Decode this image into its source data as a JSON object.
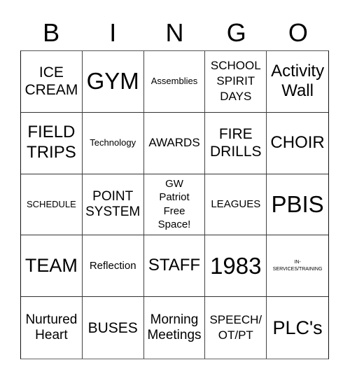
{
  "header": {
    "letters": [
      "B",
      "I",
      "N",
      "G",
      "O"
    ]
  },
  "cells": [
    {
      "text": "ICE\nCREAM",
      "size": "s-lg"
    },
    {
      "text": "GYM",
      "size": "s-xxl"
    },
    {
      "text": "Assemblies",
      "size": "s-sm"
    },
    {
      "text": "SCHOOL\nSPIRIT\nDAYS",
      "size": "s-md"
    },
    {
      "text": "Activity\nWall",
      "size": "s-lg2"
    },
    {
      "text": "FIELD\nTRIPS",
      "size": "s-lg2"
    },
    {
      "text": "Technology",
      "size": "s-sm"
    },
    {
      "text": "AWARDS",
      "size": "s-md"
    },
    {
      "text": "FIRE\nDRILLS",
      "size": "s-lg"
    },
    {
      "text": "CHOIR",
      "size": "s-lg2"
    },
    {
      "text": "SCHEDULE",
      "size": "s-sm"
    },
    {
      "text": "POINT\nSYSTEM",
      "size": "s-md2"
    },
    {
      "text": "GW\nPatriot\nFree\nSpace!",
      "size": "s-sm2"
    },
    {
      "text": "LEAGUES",
      "size": "s-sm2"
    },
    {
      "text": "PBIS",
      "size": "s-xxl"
    },
    {
      "text": "TEAM",
      "size": "s-xl"
    },
    {
      "text": "Reflection",
      "size": "s-sm2"
    },
    {
      "text": "STAFF",
      "size": "s-lg2"
    },
    {
      "text": "1983",
      "size": "s-xxl"
    },
    {
      "text": "IN-\nSERVICES/TRAINING",
      "size": "s-xs"
    },
    {
      "text": "Nurtured\nHeart",
      "size": "s-md2"
    },
    {
      "text": "BUSES",
      "size": "s-lg"
    },
    {
      "text": "Morning\nMeetings",
      "size": "s-md2"
    },
    {
      "text": "SPEECH/\nOT/PT",
      "size": "s-md"
    },
    {
      "text": "PLC's",
      "size": "s-xl"
    }
  ]
}
